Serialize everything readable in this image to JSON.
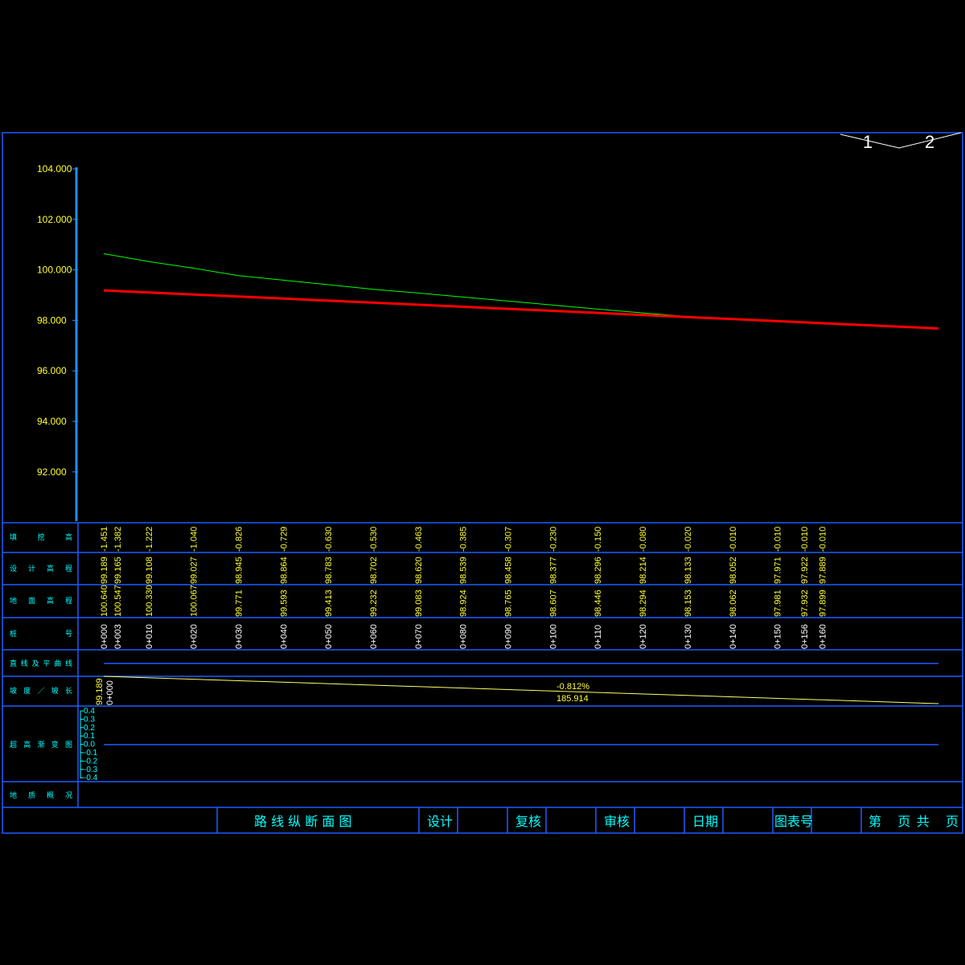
{
  "sheet": {
    "marks": [
      "1",
      "2"
    ]
  },
  "chart_data": {
    "type": "line",
    "ylim": [
      90.0,
      104.0
    ],
    "yticks": [
      "104.000",
      "102.000",
      "100.000",
      "98.000",
      "96.000",
      "94.000",
      "92.000"
    ],
    "ytick_values": [
      104,
      102,
      100,
      98,
      96,
      94,
      92
    ],
    "series": [
      {
        "color": "#00ff00",
        "x": [
          0,
          3,
          10,
          20,
          30,
          40,
          50,
          60,
          70,
          80,
          90,
          100,
          110,
          120,
          130,
          140,
          150,
          156,
          160
        ],
        "values": [
          100.64,
          100.547,
          100.33,
          100.067,
          99.771,
          99.593,
          99.413,
          99.232,
          99.083,
          98.924,
          98.765,
          98.607,
          98.446,
          98.294,
          98.153,
          98.062,
          97.981,
          97.932,
          97.899
        ]
      },
      {
        "color": "#ff0000",
        "x": [
          0,
          185.914
        ],
        "values": [
          99.189,
          97.679
        ]
      }
    ]
  },
  "table": {
    "row_labels": {
      "cut_fill": "填 挖 高",
      "design": "设 计 高 程",
      "ground": "地 面 高 程",
      "station": "桩 号",
      "alignment": "直线及平曲线",
      "grade": "坡度／坡长",
      "superelev": "超高渐变图",
      "geology": "地质概况"
    },
    "columns": [
      {
        "x": 0,
        "cut": "-1.451",
        "design": "99.189",
        "ground": "100.640",
        "station": "0+000"
      },
      {
        "x": 3,
        "cut": "-1.382",
        "design": "99.165",
        "ground": "100.547",
        "station": "0+003"
      },
      {
        "x": 10,
        "cut": "-1.222",
        "design": "99.108",
        "ground": "100.330",
        "station": "0+010"
      },
      {
        "x": 20,
        "cut": "-1.040",
        "design": "99.027",
        "ground": "100.067",
        "station": "0+020"
      },
      {
        "x": 30,
        "cut": "-0.826",
        "design": "98.945",
        "ground": "99.771",
        "station": "0+030"
      },
      {
        "x": 40,
        "cut": "-0.729",
        "design": "98.864",
        "ground": "99.593",
        "station": "0+040"
      },
      {
        "x": 50,
        "cut": "-0.630",
        "design": "98.783",
        "ground": "99.413",
        "station": "0+050"
      },
      {
        "x": 60,
        "cut": "-0.530",
        "design": "98.702",
        "ground": "99.232",
        "station": "0+060"
      },
      {
        "x": 70,
        "cut": "-0.463",
        "design": "98.620",
        "ground": "99.083",
        "station": "0+070"
      },
      {
        "x": 80,
        "cut": "-0.385",
        "design": "98.539",
        "ground": "98.924",
        "station": "0+080"
      },
      {
        "x": 90,
        "cut": "-0.307",
        "design": "98.458",
        "ground": "98.765",
        "station": "0+090"
      },
      {
        "x": 100,
        "cut": "-0.230",
        "design": "98.377",
        "ground": "98.607",
        "station": "0+100"
      },
      {
        "x": 110,
        "cut": "-0.150",
        "design": "98.296",
        "ground": "98.446",
        "station": "0+110"
      },
      {
        "x": 120,
        "cut": "-0.080",
        "design": "98.214",
        "ground": "98.294",
        "station": "0+120"
      },
      {
        "x": 130,
        "cut": "-0.020",
        "design": "98.133",
        "ground": "98.153",
        "station": "0+130"
      },
      {
        "x": 140,
        "cut": "-0.010",
        "design": "98.052",
        "ground": "98.062",
        "station": "0+140"
      },
      {
        "x": 150,
        "cut": "-0.010",
        "design": "97.971",
        "ground": "97.981",
        "station": "0+150"
      },
      {
        "x": 156,
        "cut": "-0.010",
        "design": "97.922",
        "ground": "97.932",
        "station": "0+156"
      },
      {
        "x": 160,
        "cut": "-0.010",
        "design": "97.889",
        "ground": "97.899",
        "station": "0+160"
      }
    ],
    "grade": {
      "start_elev": "99.189",
      "start_station": "0+000",
      "slope": "-0.812%",
      "length": "185.914"
    },
    "superelev_ticks": [
      "0.4",
      "0.3",
      "0.2",
      "0.1",
      "0.0",
      "-0.1",
      "-0.2",
      "-0.3",
      "-0.4"
    ]
  },
  "title_block": {
    "title": "路 线 纵 断 面 图",
    "design": "设计",
    "check": "复核",
    "review": "审核",
    "date": "日期",
    "drawing_no": "图表号",
    "page": "第 页共 页"
  }
}
